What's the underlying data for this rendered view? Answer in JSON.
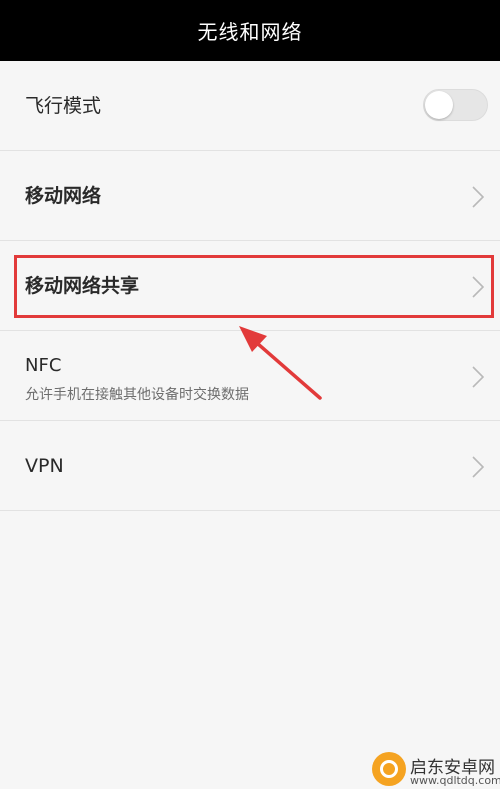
{
  "header": {
    "title": "无线和网络"
  },
  "settings": {
    "airplane_mode": {
      "label": "飞行模式",
      "enabled": false
    },
    "mobile_network": {
      "label": "移动网络"
    },
    "mobile_network_sharing": {
      "label": "移动网络共享"
    },
    "nfc": {
      "label": "NFC",
      "description": "允许手机在接触其他设备时交换数据"
    },
    "vpn": {
      "label": "VPN"
    }
  },
  "annotation": {
    "highlight_color": "#e23a3a"
  },
  "watermark": {
    "name": "启东安卓网",
    "url": "www.qdltdq.com"
  },
  "colors": {
    "topbar": "#000000",
    "background": "#f6f6f6",
    "divider": "#e2e2e2"
  },
  "icons": {
    "chevron": "chevron-right-icon",
    "toggle": "toggle-switch-off"
  }
}
